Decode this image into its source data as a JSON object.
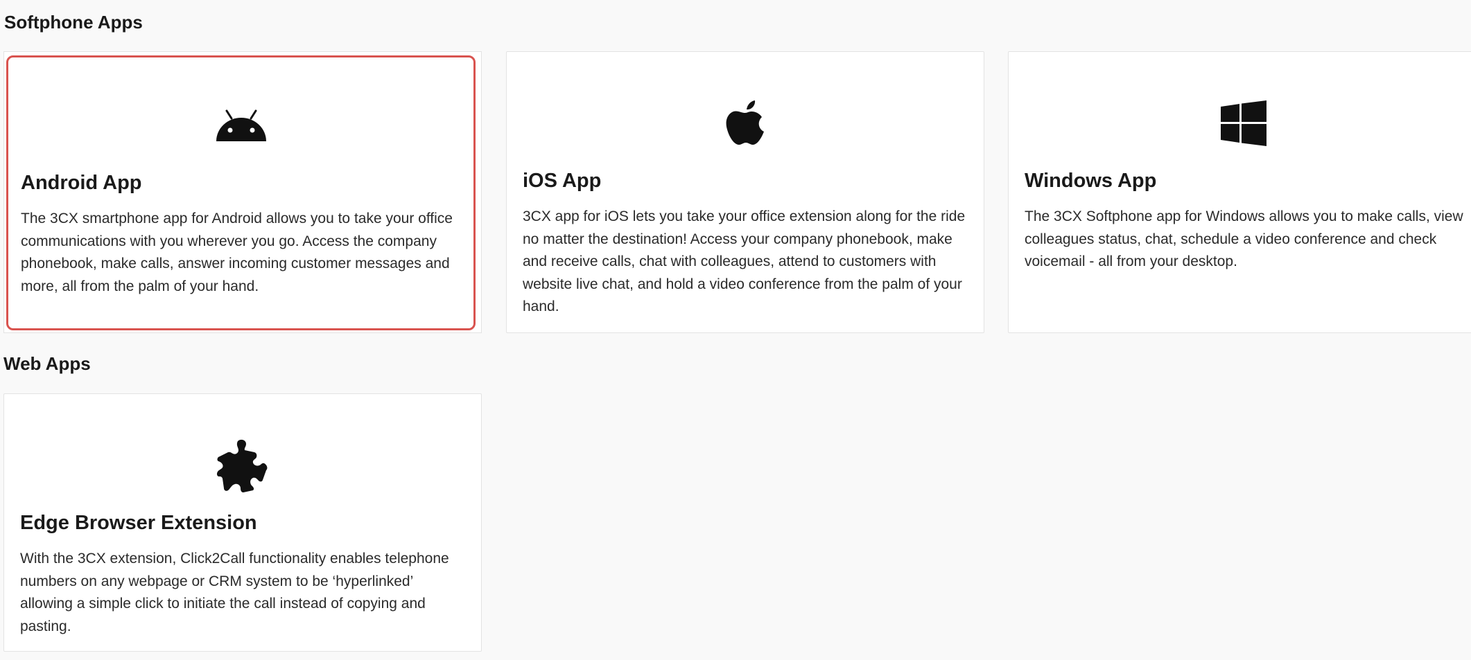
{
  "sections": {
    "softphone": {
      "title": "Softphone Apps"
    },
    "web": {
      "title": "Web Apps"
    }
  },
  "cards": {
    "android": {
      "title": "Android App",
      "description": "The 3CX smartphone app for Android allows you to take your office communications with you wherever you go. Access the company phonebook, make calls, answer incoming customer messages and more, all from the palm of your hand.",
      "icon": "android-icon",
      "selected": true
    },
    "ios": {
      "title": "iOS App",
      "description": "3CX app for iOS lets you take your office extension along for the ride no matter the destination! Access your company phonebook, make and receive calls, chat with colleagues, attend to customers with website live chat, and hold a video conference from the palm of your hand.",
      "icon": "apple-icon"
    },
    "windows": {
      "title": "Windows App",
      "description": "The 3CX Softphone app for Windows allows you to make calls, view colleagues status, chat, schedule a video conference and check voicemail - all from your desktop.",
      "icon": "windows-icon"
    },
    "edge": {
      "title": "Edge Browser Extension",
      "description": "With the 3CX extension, Click2Call functionality enables telephone numbers on any webpage or CRM system to be ‘hyperlinked’ allowing a simple click to initiate the call instead of copying and pasting.",
      "icon": "puzzle-icon"
    }
  },
  "colors": {
    "background": "#f9f9f9",
    "card": "#ffffff",
    "selected_border": "#d9534f",
    "icon": "#111111"
  }
}
